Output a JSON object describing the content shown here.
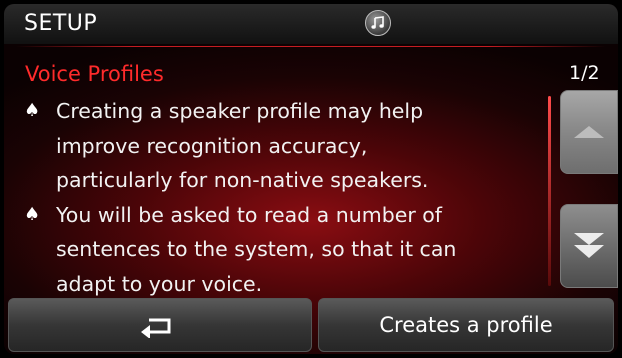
{
  "header": {
    "title": "SETUP",
    "center_icon": "music-note-icon"
  },
  "section": {
    "title": "Voice Profiles",
    "page_indicator": "1/2"
  },
  "content": {
    "bullets": [
      {
        "line1": "Creating a speaker profile may help",
        "line2": "improve recognition accuracy,",
        "line3": "particularly for non-native speakers."
      },
      {
        "line1": "You will be asked to read a number of",
        "line2": "sentences to the system, so that it can",
        "line3": "adapt to your voice."
      }
    ],
    "bullet_icon": "spade-icon"
  },
  "scroll": {
    "up_icon": "arrow-up-icon",
    "down_icon": "double-arrow-down-icon"
  },
  "footer": {
    "back_icon": "return-arrow-icon",
    "create_label": "Creates a profile"
  },
  "colors": {
    "accent_red": "#ff2b2b",
    "background_red": "#8a0d12",
    "text": "#f2f2f2"
  }
}
